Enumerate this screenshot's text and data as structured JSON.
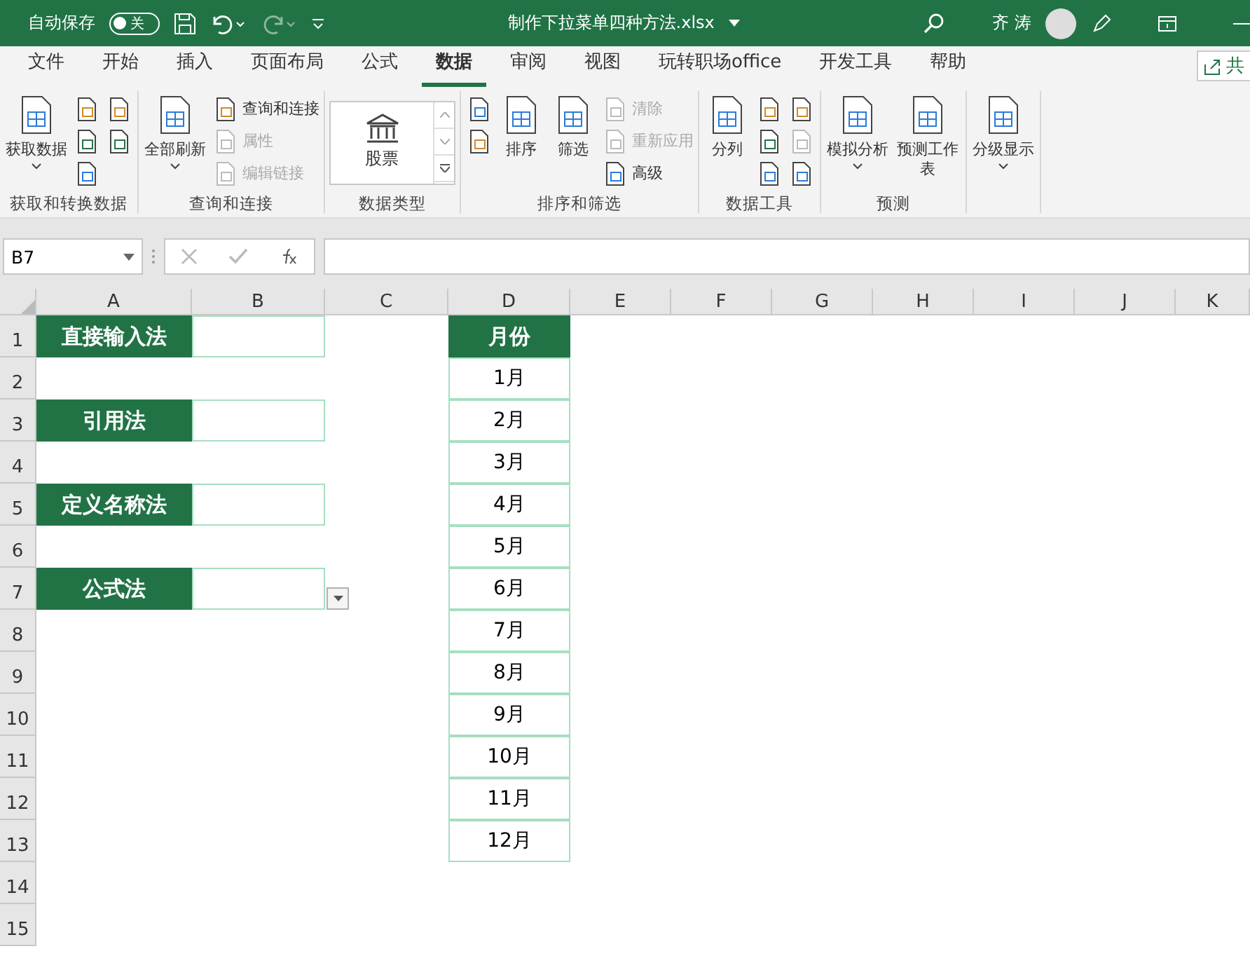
{
  "title_bar": {
    "autosave_label": "自动保存",
    "autosave_toggle": {
      "label": "关",
      "on": false
    },
    "filename": "制作下拉菜单四种方法.xlsx",
    "user_name": "齐 涛"
  },
  "tabs": [
    {
      "label": "文件",
      "selected": false
    },
    {
      "label": "开始",
      "selected": false
    },
    {
      "label": "插入",
      "selected": false
    },
    {
      "label": "页面布局",
      "selected": false
    },
    {
      "label": "公式",
      "selected": false
    },
    {
      "label": "数据",
      "selected": true
    },
    {
      "label": "审阅",
      "selected": false
    },
    {
      "label": "视图",
      "selected": false
    },
    {
      "label": "玩转职场office",
      "selected": false
    },
    {
      "label": "开发工具",
      "selected": false
    },
    {
      "label": "帮助",
      "selected": false
    }
  ],
  "share_button": "共",
  "ribbon_groups": [
    {
      "name": "获取和转换数据",
      "items": [
        {
          "kind": "large",
          "label": "获取数据",
          "menu": true,
          "disabled": false
        },
        {
          "kind": "icon",
          "disabled": false
        },
        {
          "kind": "icon",
          "disabled": false
        },
        {
          "kind": "icon",
          "disabled": false
        },
        {
          "kind": "icon",
          "disabled": false
        },
        {
          "kind": "icon",
          "disabled": false
        }
      ]
    },
    {
      "name": "查询和连接",
      "items": [
        {
          "kind": "large",
          "label": "全部刷新",
          "menu": true,
          "disabled": false
        },
        {
          "kind": "small",
          "label": "查询和连接",
          "disabled": false
        },
        {
          "kind": "small",
          "label": "属性",
          "disabled": true
        },
        {
          "kind": "small",
          "label": "编辑链接",
          "disabled": true
        }
      ]
    },
    {
      "name": "数据类型",
      "items": [
        {
          "kind": "gallery",
          "label": "股票"
        }
      ]
    },
    {
      "name": "排序和筛选",
      "items": [
        {
          "kind": "icon",
          "disabled": false
        },
        {
          "kind": "icon",
          "disabled": false
        },
        {
          "kind": "large",
          "label": "排序",
          "menu": false,
          "disabled": false
        },
        {
          "kind": "large",
          "label": "筛选",
          "menu": false,
          "disabled": false
        },
        {
          "kind": "small",
          "label": "清除",
          "disabled": true
        },
        {
          "kind": "small",
          "label": "重新应用",
          "disabled": true
        },
        {
          "kind": "small",
          "label": "高级",
          "disabled": false
        }
      ]
    },
    {
      "name": "数据工具",
      "items": [
        {
          "kind": "large",
          "label": "分列",
          "menu": false,
          "disabled": false
        },
        {
          "kind": "icon",
          "disabled": false
        },
        {
          "kind": "icon",
          "disabled": false
        },
        {
          "kind": "icon",
          "disabled": false
        },
        {
          "kind": "icon",
          "disabled": false
        },
        {
          "kind": "icon",
          "disabled": true
        },
        {
          "kind": "icon",
          "disabled": false
        }
      ]
    },
    {
      "name": "预测",
      "items": [
        {
          "kind": "large",
          "label": "模拟分析",
          "menu": true,
          "disabled": false
        },
        {
          "kind": "large",
          "label": "预测工作表",
          "menu": false,
          "disabled": false
        }
      ]
    },
    {
      "items": [
        {
          "kind": "large",
          "label": "分级显示",
          "menu": true,
          "disabled": false
        }
      ]
    }
  ],
  "formula_bar": {
    "name_box": "B7"
  },
  "sheet": {
    "columns": [
      "A",
      "B",
      "C",
      "D",
      "E",
      "F",
      "G",
      "H",
      "I",
      "J",
      "K"
    ],
    "rows": [
      {
        "number": "1",
        "A": {
          "kind": "header",
          "text": "直接输入法"
        },
        "B": {
          "kind": "bordered"
        },
        "D": {
          "kind": "header",
          "text": "月份"
        }
      },
      {
        "number": "2",
        "D": {
          "kind": "value",
          "text": "1月"
        }
      },
      {
        "number": "3",
        "A": {
          "kind": "header",
          "text": "引用法"
        },
        "B": {
          "kind": "bordered"
        },
        "D": {
          "kind": "value",
          "text": "2月"
        }
      },
      {
        "number": "4",
        "D": {
          "kind": "value",
          "text": "3月"
        }
      },
      {
        "number": "5",
        "A": {
          "kind": "header",
          "text": "定义名称法"
        },
        "B": {
          "kind": "bordered"
        },
        "D": {
          "kind": "value",
          "text": "4月"
        }
      },
      {
        "number": "6",
        "D": {
          "kind": "value",
          "text": "5月"
        }
      },
      {
        "number": "7",
        "A": {
          "kind": "header",
          "text": "公式法"
        },
        "B": {
          "kind": "bordered",
          "dropdown": true
        },
        "D": {
          "kind": "value",
          "text": "6月"
        }
      },
      {
        "number": "8",
        "D": {
          "kind": "value",
          "text": "7月"
        }
      },
      {
        "number": "9",
        "D": {
          "kind": "value",
          "text": "8月"
        }
      },
      {
        "number": "10",
        "D": {
          "kind": "value",
          "text": "9月"
        }
      },
      {
        "number": "11",
        "D": {
          "kind": "value",
          "text": "10月"
        }
      },
      {
        "number": "12",
        "D": {
          "kind": "value",
          "text": "11月"
        }
      },
      {
        "number": "13",
        "D": {
          "kind": "value",
          "text": "12月"
        }
      },
      {
        "number": "14"
      },
      {
        "number": "15"
      }
    ]
  }
}
